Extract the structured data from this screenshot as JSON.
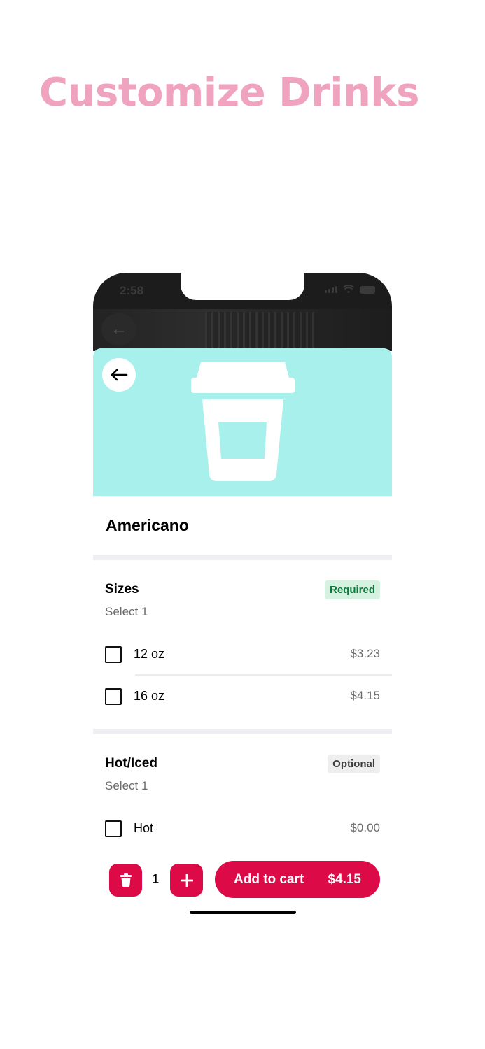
{
  "page": {
    "headline": "Customize Drinks"
  },
  "status_bar": {
    "time": "2:58"
  },
  "product": {
    "name": "Americano",
    "hero_color": "#a8f0eb"
  },
  "sections": [
    {
      "title": "Sizes",
      "subtitle": "Select 1",
      "badge": "Required",
      "options": [
        {
          "label": "12 oz",
          "price": "$3.23",
          "checked": false
        },
        {
          "label": "16 oz",
          "price": "$4.15",
          "checked": false
        }
      ]
    },
    {
      "title": "Hot/Iced",
      "subtitle": "Select 1",
      "badge": "Optional",
      "options": [
        {
          "label": "Hot",
          "price": "$0.00",
          "checked": false
        }
      ]
    }
  ],
  "footer": {
    "quantity": "1",
    "add_to_cart_label": "Add to cart",
    "total": "$4.15"
  },
  "colors": {
    "accent": "#dc0a46",
    "headline": "#f0a3bf",
    "required_badge": "#0c7a3c"
  }
}
